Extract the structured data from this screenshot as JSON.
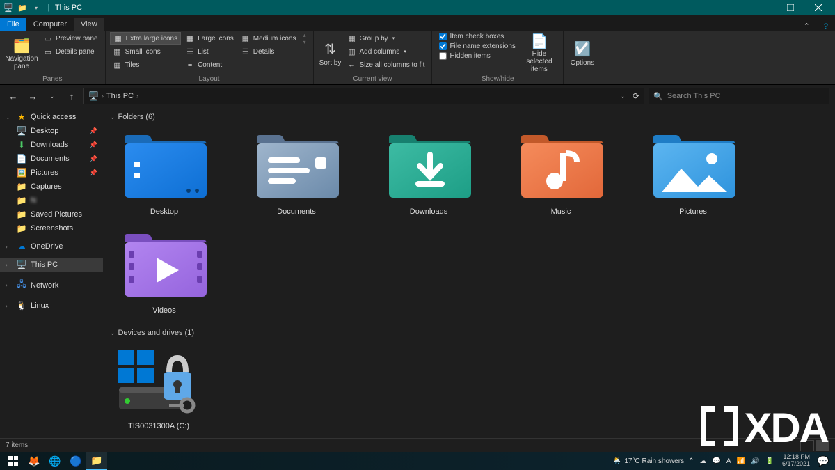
{
  "titlebar": {
    "title": "This PC"
  },
  "menutabs": {
    "file": "File",
    "computer": "Computer",
    "view": "View"
  },
  "ribbon": {
    "panes": {
      "label": "Panes",
      "navigation": "Navigation pane",
      "preview": "Preview pane",
      "details": "Details pane"
    },
    "layout": {
      "label": "Layout",
      "extra_large": "Extra large icons",
      "large": "Large icons",
      "medium": "Medium icons",
      "small": "Small icons",
      "list": "List",
      "details": "Details",
      "tiles": "Tiles",
      "content": "Content"
    },
    "current_view": {
      "label": "Current view",
      "sort_by": "Sort by",
      "group_by": "Group by",
      "add_columns": "Add columns",
      "size_all": "Size all columns to fit"
    },
    "show_hide": {
      "label": "Show/hide",
      "item_check": "Item check boxes",
      "file_ext": "File name extensions",
      "hidden": "Hidden items",
      "hide_selected": "Hide selected items"
    },
    "options": "Options"
  },
  "addrbar": {
    "location": "This PC"
  },
  "search": {
    "placeholder": "Search This PC"
  },
  "sidebar": {
    "quick_access": "Quick access",
    "desktop": "Desktop",
    "downloads": "Downloads",
    "documents": "Documents",
    "pictures": "Pictures",
    "captures": "Captures",
    "n": "N",
    "saved_pictures": "Saved Pictures",
    "screenshots": "Screenshots",
    "onedrive": "OneDrive",
    "this_pc": "This PC",
    "network": "Network",
    "linux": "Linux"
  },
  "sections": {
    "folders": "Folders (6)",
    "drives": "Devices and drives (1)"
  },
  "folders": {
    "desktop": "Desktop",
    "documents": "Documents",
    "downloads": "Downloads",
    "music": "Music",
    "pictures": "Pictures",
    "videos": "Videos"
  },
  "drives": {
    "c": "TIS0031300A (C:)"
  },
  "statusbar": {
    "items": "7 items"
  },
  "taskbar": {
    "weather": "17°C  Rain showers",
    "time": "12:18 PM",
    "date": "6/17/2021"
  },
  "watermark": "XDA"
}
